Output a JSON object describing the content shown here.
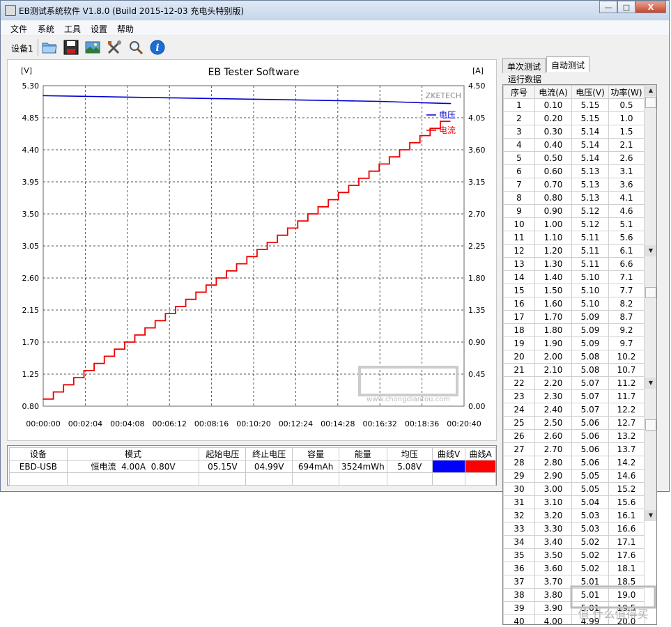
{
  "window": {
    "title": "EB测试系统软件 V1.8.0 (Build 2015-12-03 充电头特别版)",
    "min_label": "—",
    "max_label": "□",
    "close_label": "X"
  },
  "menu": [
    "文件",
    "系统",
    "工具",
    "设置",
    "帮助"
  ],
  "toolbar": {
    "device_label": "设备1",
    "icons": [
      "folder-icon",
      "save-icon",
      "image-icon",
      "tools-icon",
      "search-icon",
      "info-icon"
    ]
  },
  "chart_data": {
    "type": "line",
    "title": "EB Tester Software",
    "brand_label": "ZKETECH",
    "y_left_unit": "[V]",
    "y_right_unit": "[A]",
    "y_left_ticks": [
      "5.30",
      "4.85",
      "4.40",
      "3.95",
      "3.50",
      "3.05",
      "2.60",
      "2.15",
      "1.70",
      "1.25",
      "0.80"
    ],
    "y_right_ticks": [
      "4.50",
      "4.05",
      "3.60",
      "3.15",
      "2.70",
      "2.25",
      "1.80",
      "1.35",
      "0.90",
      "0.45",
      "0.00"
    ],
    "ylim_left": [
      0.8,
      5.3
    ],
    "ylim_right": [
      0.0,
      4.5
    ],
    "x_ticks": [
      "00:00:00",
      "00:02:04",
      "00:04:08",
      "00:06:12",
      "00:08:16",
      "00:10:20",
      "00:12:24",
      "00:14:28",
      "00:16:32",
      "00:18:36",
      "00:20:40"
    ],
    "xlim_seconds": [
      0,
      1240
    ],
    "grid": true,
    "legend_position": "top-right",
    "series": [
      {
        "name": "电压",
        "color": "#0000cc",
        "axis": "left",
        "x_seconds": [
          0,
          124,
          248,
          372,
          496,
          620,
          744,
          868,
          992,
          1116,
          1200
        ],
        "values": [
          5.16,
          5.15,
          5.14,
          5.13,
          5.12,
          5.11,
          5.1,
          5.09,
          5.08,
          5.06,
          5.05
        ]
      },
      {
        "name": "电流",
        "color": "#ee0000",
        "axis": "right",
        "step_seconds": 30,
        "start_seconds": 0,
        "values": [
          0.1,
          0.2,
          0.3,
          0.4,
          0.5,
          0.6,
          0.7,
          0.8,
          0.9,
          1.0,
          1.1,
          1.2,
          1.3,
          1.4,
          1.5,
          1.6,
          1.7,
          1.8,
          1.9,
          2.0,
          2.1,
          2.2,
          2.3,
          2.4,
          2.5,
          2.6,
          2.7,
          2.8,
          2.9,
          3.0,
          3.1,
          3.2,
          3.3,
          3.4,
          3.5,
          3.6,
          3.7,
          3.8,
          3.9,
          4.0
        ]
      }
    ]
  },
  "summary": {
    "headers": [
      "设备",
      "模式",
      "起始电压",
      "终止电压",
      "容量",
      "能量",
      "均压",
      "曲线V",
      "曲线A"
    ],
    "row": [
      "EBD-USB",
      "恒电流  4.00A  0.80V",
      "05.15V",
      "04.99V",
      "694mAh",
      "3524mWh",
      "5.08V"
    ],
    "colors": [
      "#0000ff",
      "#ff0000"
    ]
  },
  "panel": {
    "tabs": [
      "单次测试",
      "自动测试"
    ],
    "group_label": "运行数据",
    "columns": [
      "序号",
      "电流(A)",
      "电压(V)",
      "功率(W)"
    ],
    "rows": [
      [
        "1",
        "0.10",
        "5.15",
        "0.5"
      ],
      [
        "2",
        "0.20",
        "5.15",
        "1.0"
      ],
      [
        "3",
        "0.30",
        "5.14",
        "1.5"
      ],
      [
        "4",
        "0.40",
        "5.14",
        "2.1"
      ],
      [
        "5",
        "0.50",
        "5.14",
        "2.6"
      ],
      [
        "6",
        "0.60",
        "5.13",
        "3.1"
      ],
      [
        "7",
        "0.70",
        "5.13",
        "3.6"
      ],
      [
        "8",
        "0.80",
        "5.13",
        "4.1"
      ],
      [
        "9",
        "0.90",
        "5.12",
        "4.6"
      ],
      [
        "10",
        "1.00",
        "5.12",
        "5.1"
      ],
      [
        "11",
        "1.10",
        "5.11",
        "5.6"
      ],
      [
        "12",
        "1.20",
        "5.11",
        "6.1"
      ],
      [
        "13",
        "1.30",
        "5.11",
        "6.6"
      ],
      [
        "14",
        "1.40",
        "5.10",
        "7.1"
      ],
      [
        "15",
        "1.50",
        "5.10",
        "7.7"
      ],
      [
        "16",
        "1.60",
        "5.10",
        "8.2"
      ],
      [
        "17",
        "1.70",
        "5.09",
        "8.7"
      ],
      [
        "18",
        "1.80",
        "5.09",
        "9.2"
      ],
      [
        "19",
        "1.90",
        "5.09",
        "9.7"
      ],
      [
        "20",
        "2.00",
        "5.08",
        "10.2"
      ],
      [
        "21",
        "2.10",
        "5.08",
        "10.7"
      ],
      [
        "22",
        "2.20",
        "5.07",
        "11.2"
      ],
      [
        "23",
        "2.30",
        "5.07",
        "11.7"
      ],
      [
        "24",
        "2.40",
        "5.07",
        "12.2"
      ],
      [
        "25",
        "2.50",
        "5.06",
        "12.7"
      ],
      [
        "26",
        "2.60",
        "5.06",
        "13.2"
      ],
      [
        "27",
        "2.70",
        "5.06",
        "13.7"
      ],
      [
        "28",
        "2.80",
        "5.06",
        "14.2"
      ],
      [
        "29",
        "2.90",
        "5.05",
        "14.6"
      ],
      [
        "30",
        "3.00",
        "5.05",
        "15.2"
      ],
      [
        "31",
        "3.10",
        "5.04",
        "15.6"
      ],
      [
        "32",
        "3.20",
        "5.03",
        "16.1"
      ],
      [
        "33",
        "3.30",
        "5.03",
        "16.6"
      ],
      [
        "34",
        "3.40",
        "5.02",
        "17.1"
      ],
      [
        "35",
        "3.50",
        "5.02",
        "17.6"
      ],
      [
        "36",
        "3.60",
        "5.02",
        "18.1"
      ],
      [
        "37",
        "3.70",
        "5.01",
        "18.5"
      ],
      [
        "38",
        "3.80",
        "5.01",
        "19.0"
      ],
      [
        "39",
        "3.90",
        "5.01",
        "19.5"
      ],
      [
        "40",
        "4.00",
        "4.99",
        "20.0"
      ]
    ]
  },
  "watermark": {
    "text": "值 什么值得买",
    "domain": "www.chongdiantou.com"
  }
}
